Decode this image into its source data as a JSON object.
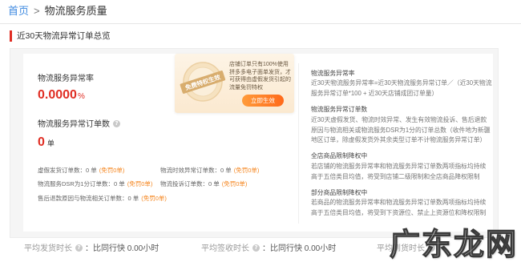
{
  "breadcrumb": {
    "home": "首页",
    "separator": ">",
    "current": "物流服务质量"
  },
  "section": {
    "title": "近30天物流异常订单总览"
  },
  "metrics": {
    "abnormal_rate": {
      "label": "物流服务异常率",
      "value": "0.0000",
      "unit": "%"
    },
    "abnormal_orders": {
      "label": "物流服务异常订单数",
      "value": "0",
      "unit": "单"
    }
  },
  "sub_stats": [
    {
      "label": "虚假发货订单数：0 单",
      "exempt": "(免罚0单)"
    },
    {
      "label": "物流时效异常订单数：0 单",
      "exempt": "(免罚0单)"
    },
    {
      "label": "物流服务DSR为1分订单数：0 单",
      "exempt": "(免罚0单)"
    },
    {
      "label": "物流投诉订单数：0 单",
      "exempt": "(免罚0单)"
    },
    {
      "label": "售后退款原因与物流相关订单数：0 单",
      "exempt": "(免罚0单)"
    }
  ],
  "promo": {
    "badge_text": "免费特权生效",
    "text": "店铺订单只有100%使用拼多多电子面单发货，才可获得由虚假发货引起的流量免罚特权",
    "button_label": "立即生效"
  },
  "explanations": [
    {
      "title": "物流服务异常率",
      "body": "近30天物流服务异常率=近30天物流服务异常订单／（近30天物流服务异常订单*100 + 近30天店铺成团订单量）"
    },
    {
      "title": "物流服务异常订单数",
      "body": "近30天虚假发货、物流时效异常、发生有效物流投诉、售后退款原因与物流相关或物流服务DSR为1分的订单总数（收件地为新疆地区订单，除虚假发货外其余类型订单不计物流服务异常订单）"
    },
    {
      "title": "全店商品限制降权中",
      "body": "若店铺的物流服务异常率和物流服务异常订单数两项指标均持续高于五倍类目均值，将受到店铺二级限制和全店商品降权限制"
    },
    {
      "title": "部分商品限制降权中",
      "body": "若商品的物流服务异常率和物流服务异常订单数两项指标均持续高于五倍类目均值，将受到下资源位、禁止上资源位和降权限制"
    }
  ],
  "bottom_stats": [
    {
      "label": "平均发货时长",
      "value": "：比同行快 0.00小时"
    },
    {
      "label": "平均签收时长",
      "value": "：比同行快 0.00小时"
    },
    {
      "label": "平均到货时长"
    }
  ],
  "watermark": "广东龙网",
  "icons": {
    "help": "question-circle-icon",
    "badge": "privilege-badge-icon"
  },
  "colors": {
    "brand_red": "#e02e24",
    "link_blue": "#3f8ae0",
    "exempt_orange": "#f5861f",
    "button_orange": "#ff6a1a"
  }
}
